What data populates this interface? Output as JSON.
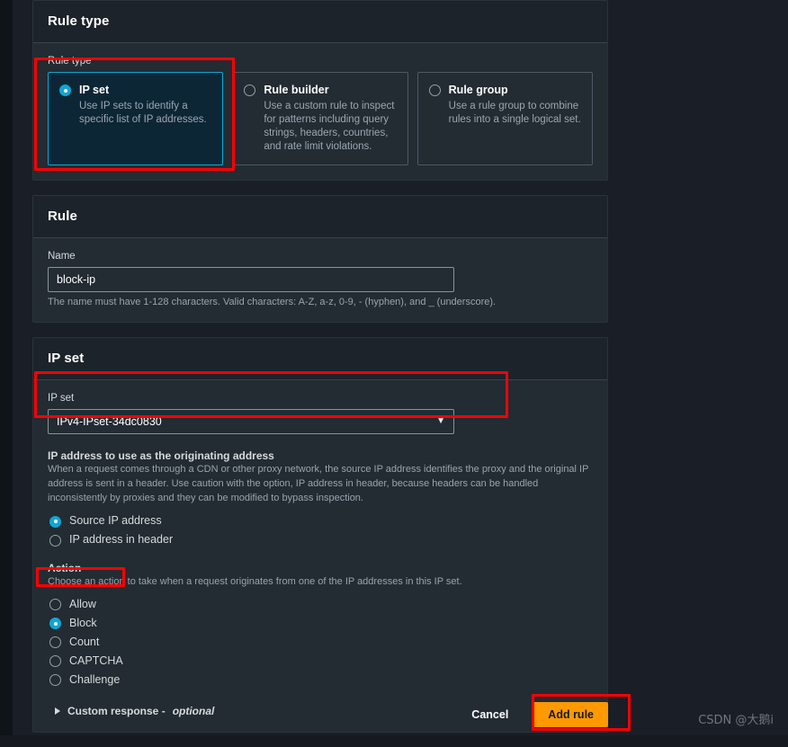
{
  "accent": {
    "selected_blue": "#0fa7d4",
    "selected_tile_bg": "#0d2636",
    "primary_button": "#ff9900",
    "annotation_red": "#ff0000"
  },
  "rule_type_panel": {
    "title": "Rule type",
    "field_label": "Rule type",
    "options": [
      {
        "name": "IP set",
        "description": "Use IP sets to identify a specific list of IP addresses.",
        "selected": true
      },
      {
        "name": "Rule builder",
        "description": "Use a custom rule to inspect for patterns including query strings, headers, countries, and rate limit violations.",
        "selected": false
      },
      {
        "name": "Rule group",
        "description": "Use a rule group to combine rules into a single logical set.",
        "selected": false
      }
    ]
  },
  "rule_panel": {
    "title": "Rule",
    "name_label": "Name",
    "name_value": "block-ip",
    "name_placeholder": "",
    "name_help": "The name must have 1-128 characters. Valid characters: A-Z, a-z, 0-9, - (hyphen), and _ (underscore)."
  },
  "ipset_panel": {
    "title": "IP set",
    "select_label": "IP set",
    "select_value": "IPv4-IPset-34dc0830",
    "caret_icon": "chevron-down-icon",
    "originating": {
      "title": "IP address to use as the originating address",
      "description": "When a request comes through a CDN or other proxy network, the source IP address identifies the proxy and the original IP address is sent in a header. Use caution with the option, IP address in header, because headers can be handled inconsistently by proxies and they can be modified to bypass inspection.",
      "options": [
        {
          "label": "Source IP address",
          "selected": true
        },
        {
          "label": "IP address in header",
          "selected": false
        }
      ]
    },
    "action": {
      "title": "Action",
      "description": "Choose an action to take when a request originates from one of the IP addresses in this IP set.",
      "options": [
        {
          "label": "Allow",
          "selected": false
        },
        {
          "label": "Block",
          "selected": true
        },
        {
          "label": "Count",
          "selected": false
        },
        {
          "label": "CAPTCHA",
          "selected": false
        },
        {
          "label": "Challenge",
          "selected": false
        }
      ]
    },
    "custom_response": {
      "label": "Custom response -",
      "optional": "optional",
      "icon": "triangle-right-icon",
      "expanded": false
    }
  },
  "footer": {
    "cancel_label": "Cancel",
    "submit_label": "Add rule"
  },
  "watermark": {
    "text": "CSDN @大鹅i"
  }
}
